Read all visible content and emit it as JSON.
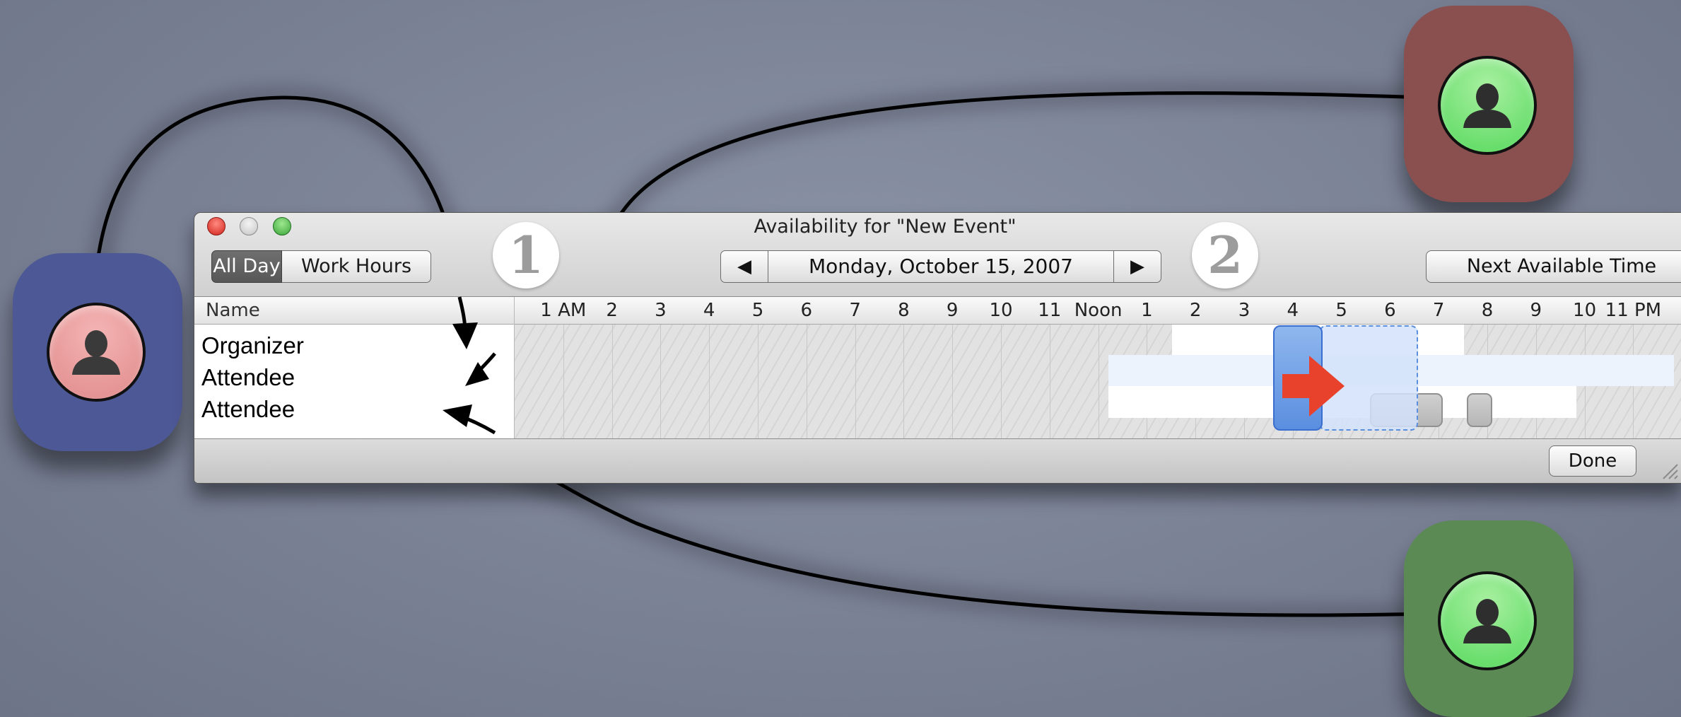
{
  "window": {
    "title": "Availability for \"New Event\"",
    "controls": {
      "close": "close-button",
      "minimize": "minimize-button",
      "zoom": "zoom-button"
    }
  },
  "toolbar": {
    "range_options": [
      "All Day",
      "Work Hours"
    ],
    "selected_range": "All Day",
    "prev_glyph": "◀",
    "date": "Monday, October 15, 2007",
    "next_glyph": "▶",
    "next_available_label": "Next Available Time"
  },
  "grid": {
    "name_header": "Name",
    "hour_labels": [
      "1 AM",
      "2",
      "3",
      "4",
      "5",
      "6",
      "7",
      "8",
      "9",
      "10",
      "11",
      "Noon",
      "1",
      "2",
      "3",
      "4",
      "5",
      "6",
      "7",
      "8",
      "9",
      "10",
      "11 PM"
    ],
    "attendees": [
      "Organizer",
      "Attendee",
      "Attendee"
    ]
  },
  "footer": {
    "done_label": "Done"
  },
  "annotations": {
    "badges": [
      "1",
      "2"
    ],
    "avatars": [
      {
        "role": "organizer",
        "tile_color": "#4d5896",
        "circle_color": "#e89a9a",
        "icon": "person-icon"
      },
      {
        "role": "attendee",
        "tile_color": "#8a4f4f",
        "circle_color": "#6ee070",
        "icon": "person-icon"
      },
      {
        "role": "attendee",
        "tile_color": "#5c8a55",
        "circle_color": "#6ee070",
        "icon": "person-icon"
      }
    ]
  },
  "colors": {
    "event_blue": "#5a8edf",
    "busy_gray": "#b6b6b6",
    "move_arrow_red": "#e8412c"
  }
}
